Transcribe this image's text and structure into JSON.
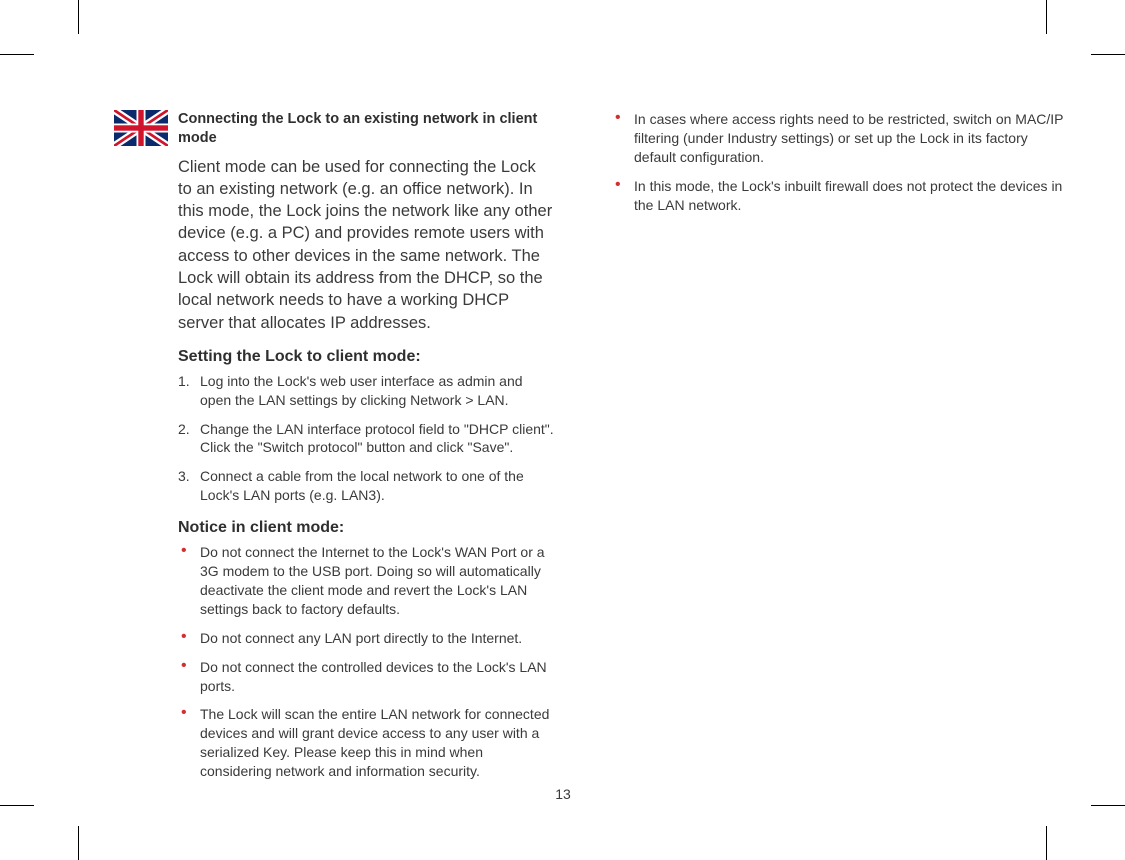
{
  "page_number": "13",
  "col1": {
    "title": "Connecting the Lock to an existing network in client mode",
    "intro": "Client mode can be used for connecting the Lock to an existing network (e.g. an office network). In this mode, the Lock joins the network like any other device (e.g. a PC) and provides remote users with access to other devices in the same network. The Lock will obtain its address from the DHCP, so the local network needs to have a working DHCP server that allocates IP addresses.",
    "setting_h": "Setting the Lock to client mode:",
    "steps": [
      "Log into the Lock's web user interface as admin and open the LAN settings by clicking Network > LAN.",
      "Change the LAN interface protocol field to \"DHCP client\". Click the \"Switch protocol\" button and click \"Save\".",
      "Connect a cable from the local network to one of the Lock's LAN ports (e.g. LAN3)."
    ],
    "notice_h": "Notice in client mode:",
    "bullets": [
      "Do not connect the Internet to the Lock's WAN Port or a 3G modem to the USB port. Doing so will automatically deactivate the client mode and revert the Lock's LAN settings back to factory defaults.",
      "Do not connect any LAN port directly to the Internet.",
      "Do not connect the controlled devices to the Lock's LAN ports.",
      "The Lock will scan the entire LAN network for connected devices and will grant device access to any user with a serialized Key. Please keep this in mind when considering network and information security."
    ]
  },
  "col2": {
    "bullets": [
      "In cases where access rights need to be restricted, switch on MAC/IP filtering (under Industry settings) or set up the Lock in its factory default configuration.",
      "In this mode, the Lock's inbuilt firewall does not protect the devices in the LAN network."
    ]
  }
}
